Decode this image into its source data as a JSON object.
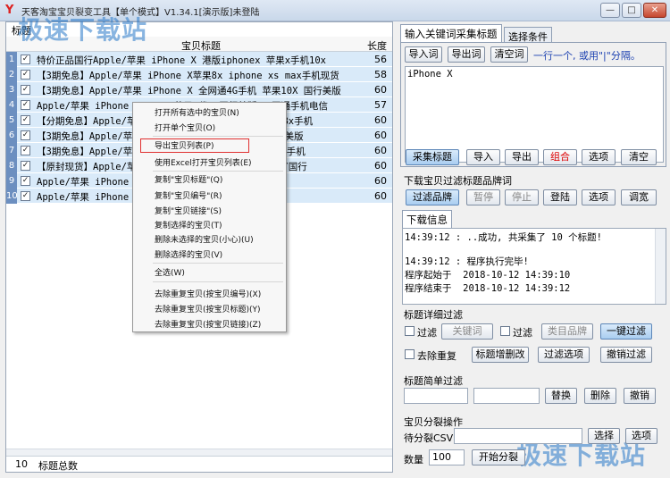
{
  "window": {
    "title": "天客淘宝宝贝裂变工具【单个模式】V1.34.1[演示版]未登陆",
    "controls": [
      "—",
      "□",
      "✕"
    ]
  },
  "watermark": "极速下载站",
  "left": {
    "tab_label": "标题",
    "col_title": "宝贝标题",
    "col_length": "长度",
    "rows": [
      {
        "n": "1",
        "title": "特价正品国行Apple/苹果 iPhone X 港版iphonex 苹果x手机10x",
        "len": "56"
      },
      {
        "n": "2",
        "title": "【3期免息】Apple/苹果 iPhone X苹果8x iphone xs max手机现货",
        "len": "58"
      },
      {
        "n": "3",
        "title": "【3期免息】Apple/苹果 iPhone X 全网通4G手机 苹果10X 国行美版",
        "len": "60"
      },
      {
        "n": "4",
        "title": "Apple/苹果 iPhone 8 Plus 苹果8代8P国行美版X三网通手机电信",
        "len": "57"
      },
      {
        "n": "5",
        "title": "【分期免息】Apple/苹果 iPhone X 苹果x手机港版美版8x手机",
        "len": "60"
      },
      {
        "n": "6",
        "title": "【3期免息】Apple/苹果 iPhone X 苹果10手机国行港版美版",
        "len": "60"
      },
      {
        "n": "7",
        "title": "【3期免息】Apple/苹果 iPhone X 全网通苹果美版8p X手机",
        "len": "60"
      },
      {
        "n": "8",
        "title": "【原封现货】Apple/苹果 iPhone X 苹果X手机现货港版/国行",
        "len": "60"
      },
      {
        "n": "9",
        "title": "Apple/苹果 iPhone X 苹果x手机国行正品吃鸡手机",
        "len": "60"
      },
      {
        "n": "10",
        "title": "Apple/苹果 iPhone X 苹果x手机256G分期免息",
        "len": "60"
      }
    ],
    "status_count": "10",
    "status_label": "标题总数"
  },
  "context_menu": {
    "items": [
      "打开所有选中的宝贝(N)",
      "打开单个宝贝(O)",
      "导出宝贝列表(P)",
      "使用Excel打开宝贝列表(E)",
      "复制\"宝贝标题\"(Q)",
      "复制\"宝贝编号\"(R)",
      "复制\"宝贝链接\"(S)",
      "复制选择的宝贝(T)",
      "删除未选择的宝贝(小心)(U)",
      "删除选择的宝贝(V)",
      "全选(W)",
      "去除重复宝贝(按宝贝编号)(X)",
      "去除重复宝贝(按宝贝标题)(Y)",
      "去除重复宝贝(按宝贝链接)(Z)"
    ]
  },
  "right": {
    "tab_keywords": "输入关键词采集标题",
    "tab_conditions": "选择条件",
    "btn_import_kw": "导入词",
    "btn_export_kw": "导出词",
    "btn_clear_kw": "清空词",
    "hint": "一行一个, 或用\"|\"分隔。",
    "keywords_text": "iPhone X",
    "btn_collect": "采集标题",
    "btn_import": "导入",
    "btn_export": "导出",
    "btn_combine": "组合",
    "btn_options": "选项",
    "btn_clear": "清空",
    "section_filter_brand": "下载宝贝过滤标题品牌词",
    "btn_filter_brand": "过滤品牌",
    "btn_pause": "暂停",
    "btn_stop": "停止",
    "btn_login": "登陆",
    "btn_options2": "选项",
    "btn_adjust": "调宽",
    "tab_download_info": "下载信息",
    "log_text": "14:39:12 : ..成功, 共采集了 10 个标题!\n\n14:39:12 : 程序执行完毕!\n程序起始于  2018-10-12 14:39:10\n程序结束于  2018-10-12 14:39:12",
    "section_detail_filter": "标题详细过滤",
    "cb_filter1": "过滤",
    "btn_keyword": "关键词",
    "cb_filter2": "过滤",
    "btn_category_brand": "类目品牌",
    "btn_one_click_filter": "一键过滤",
    "cb_dedupe": "去除重复",
    "btn_title_edit": "标题增删改",
    "btn_filter_options": "过滤选项",
    "btn_undo_filter": "撤销过滤",
    "section_simple_filter": "标题简单过滤",
    "btn_replace": "替换",
    "btn_delete": "删除",
    "btn_undo": "撤销",
    "section_split": "宝贝分裂操作",
    "label_pending": "待分裂CSV",
    "btn_select": "选择",
    "btn_options3": "选项",
    "label_quantity": "数量",
    "quantity_value": "100",
    "btn_start_split": "开始分裂"
  }
}
